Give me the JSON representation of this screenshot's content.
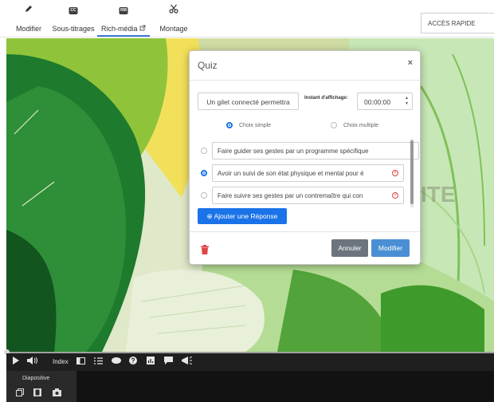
{
  "toolbar": {
    "tools": [
      {
        "label": "Modifier",
        "icon": "pencil-icon"
      },
      {
        "label": "Sous-titrages",
        "icon": "cc-icon",
        "badge": "CC"
      },
      {
        "label": "Rich-média",
        "icon": "rm-icon",
        "badge": "RM",
        "active": true
      },
      {
        "label": "Montage",
        "icon": "scissors-icon"
      }
    ],
    "quick_access": "ACCÈS RAPIDE"
  },
  "modal": {
    "title": "Quiz",
    "close": "×",
    "question_value": "Un gilet connecté permettra",
    "display_time_label": "Instant d'affichage:",
    "display_time_value": "00:00:00",
    "choice_single": "Choix simple",
    "choice_multiple": "Choix multiple",
    "answers": [
      {
        "text": "Faire guider ses gestes par un programme spécifique",
        "selected": false
      },
      {
        "text": "Avoir un suivi de son état physique et mental pour é",
        "selected": true
      },
      {
        "text": "Faire suivre ses gestes par un contremaître qui con",
        "selected": false
      }
    ],
    "add_answer_label": "Ajouter une Réponse",
    "cancel_label": "Annuler",
    "submit_label": "Modifier"
  },
  "player": {
    "index_label": "Index",
    "slide_tab_label": "Diapositive"
  },
  "colors": {
    "accent": "#1a73e8",
    "danger": "#e04444",
    "cancel": "#6c757d",
    "stage_green": "#7fb83f"
  }
}
